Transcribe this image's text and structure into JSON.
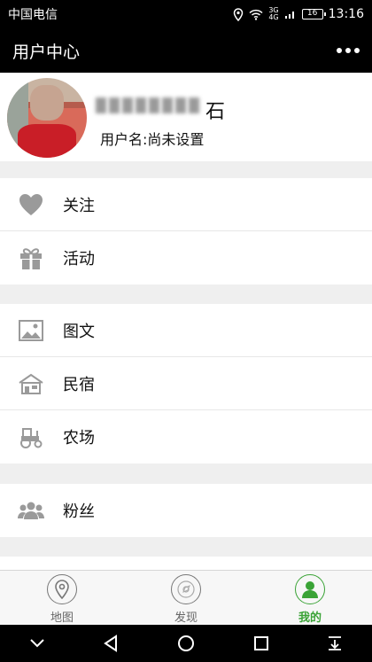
{
  "status_bar": {
    "carrier": "中国电信",
    "network_top": "3G",
    "network_bottom": "4G",
    "battery": "16",
    "time": "13:16"
  },
  "header": {
    "title": "用户中心",
    "more_icon": "more-dots-icon"
  },
  "profile": {
    "nickname_visible": "石",
    "username_label": "用户名:",
    "username_value": "尚未设置"
  },
  "menu_groups": [
    [
      {
        "label": "关注",
        "icon": "heart-icon"
      },
      {
        "label": "活动",
        "icon": "gift-icon"
      }
    ],
    [
      {
        "label": "图文",
        "icon": "image-icon"
      },
      {
        "label": "民宿",
        "icon": "house-icon"
      },
      {
        "label": "农场",
        "icon": "tractor-icon"
      }
    ],
    [
      {
        "label": "粉丝",
        "icon": "fans-icon"
      }
    ]
  ],
  "tabbar": [
    {
      "label": "地图",
      "icon": "map-pin-icon",
      "active": false
    },
    {
      "label": "发现",
      "icon": "discover-icon",
      "active": false
    },
    {
      "label": "我的",
      "icon": "user-icon",
      "active": true
    }
  ],
  "colors": {
    "accent": "#3aa336",
    "icon_gray": "#9a9a9a",
    "header_bg": "#000000"
  }
}
